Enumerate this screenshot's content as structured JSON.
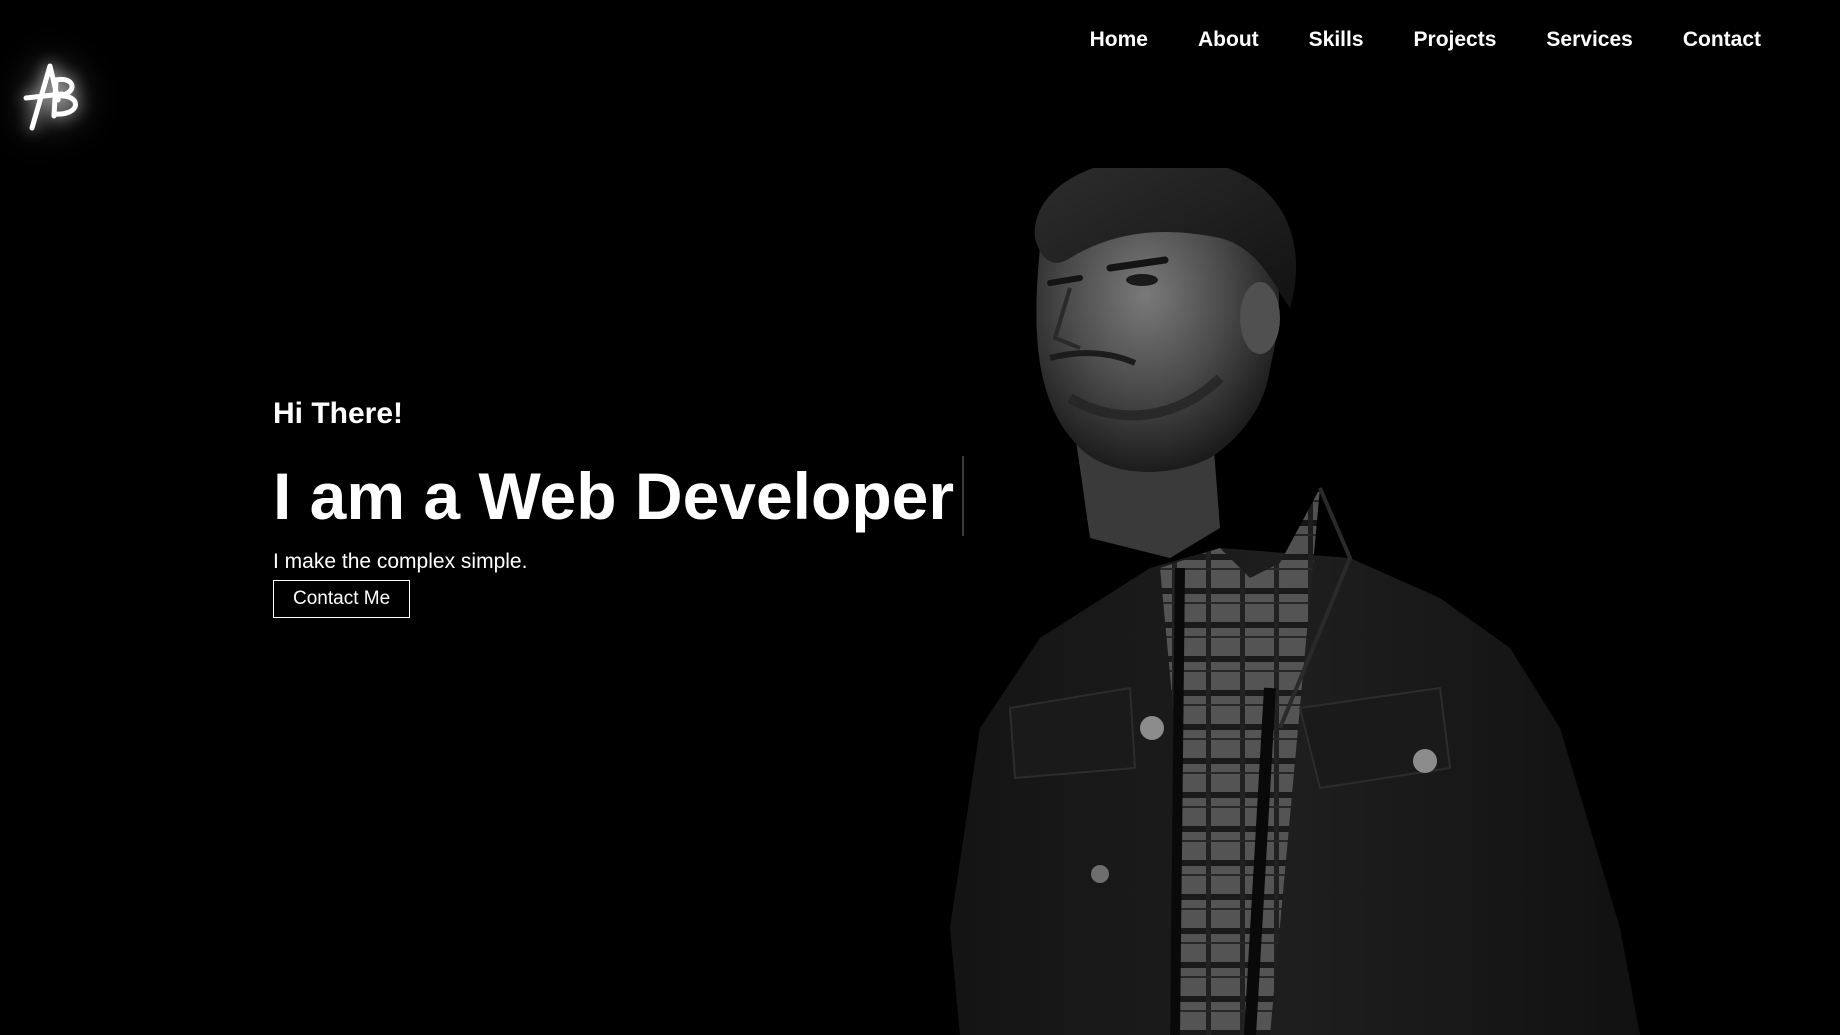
{
  "logo": {
    "icon": "ab-monogram-logo",
    "text": "AB",
    "glow_color": "#ffffff"
  },
  "nav": {
    "items": [
      {
        "label": "Home"
      },
      {
        "label": "About"
      },
      {
        "label": "Skills"
      },
      {
        "label": "Projects"
      },
      {
        "label": "Services"
      },
      {
        "label": "Contact"
      }
    ]
  },
  "hero": {
    "greeting": "Hi There!",
    "headline": "I am a Web Developer",
    "tagline": "I make the complex simple.",
    "cta_label": "Contact Me"
  },
  "portrait": {
    "icon": "person-portrait-image",
    "tone": "grayscale"
  },
  "colors": {
    "background": "#000000",
    "text": "#ffffff"
  }
}
